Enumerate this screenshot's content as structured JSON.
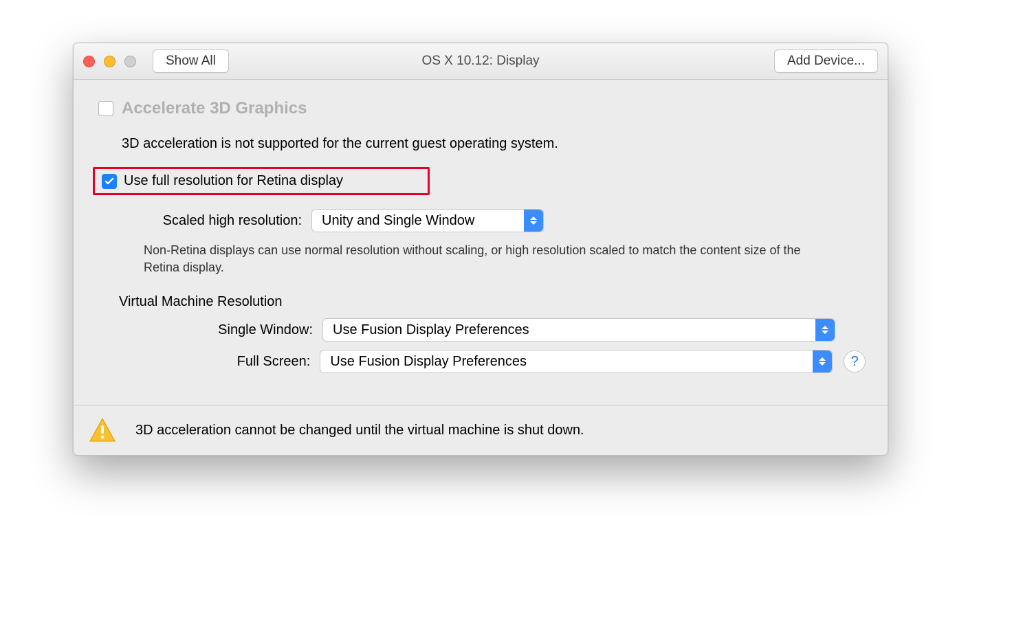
{
  "titlebar": {
    "show_all": "Show All",
    "title": "OS X 10.12: Display",
    "add_device": "Add Device..."
  },
  "accelerate": {
    "label": "Accelerate 3D Graphics",
    "desc": "3D acceleration is not supported for the current guest operating system."
  },
  "retina": {
    "label": "Use full resolution for Retina display"
  },
  "scaled": {
    "label": "Scaled high resolution:",
    "value": "Unity and Single Window",
    "help": "Non-Retina displays can use normal resolution without scaling, or high resolution scaled to match the content size of the Retina display."
  },
  "vmres": {
    "heading": "Virtual Machine Resolution",
    "single_label": "Single Window:",
    "single_value": "Use Fusion Display Preferences",
    "full_label": "Full Screen:",
    "full_value": "Use Fusion Display Preferences"
  },
  "help_button": "?",
  "footer": {
    "text": "3D acceleration cannot be changed until the virtual machine is shut down."
  }
}
